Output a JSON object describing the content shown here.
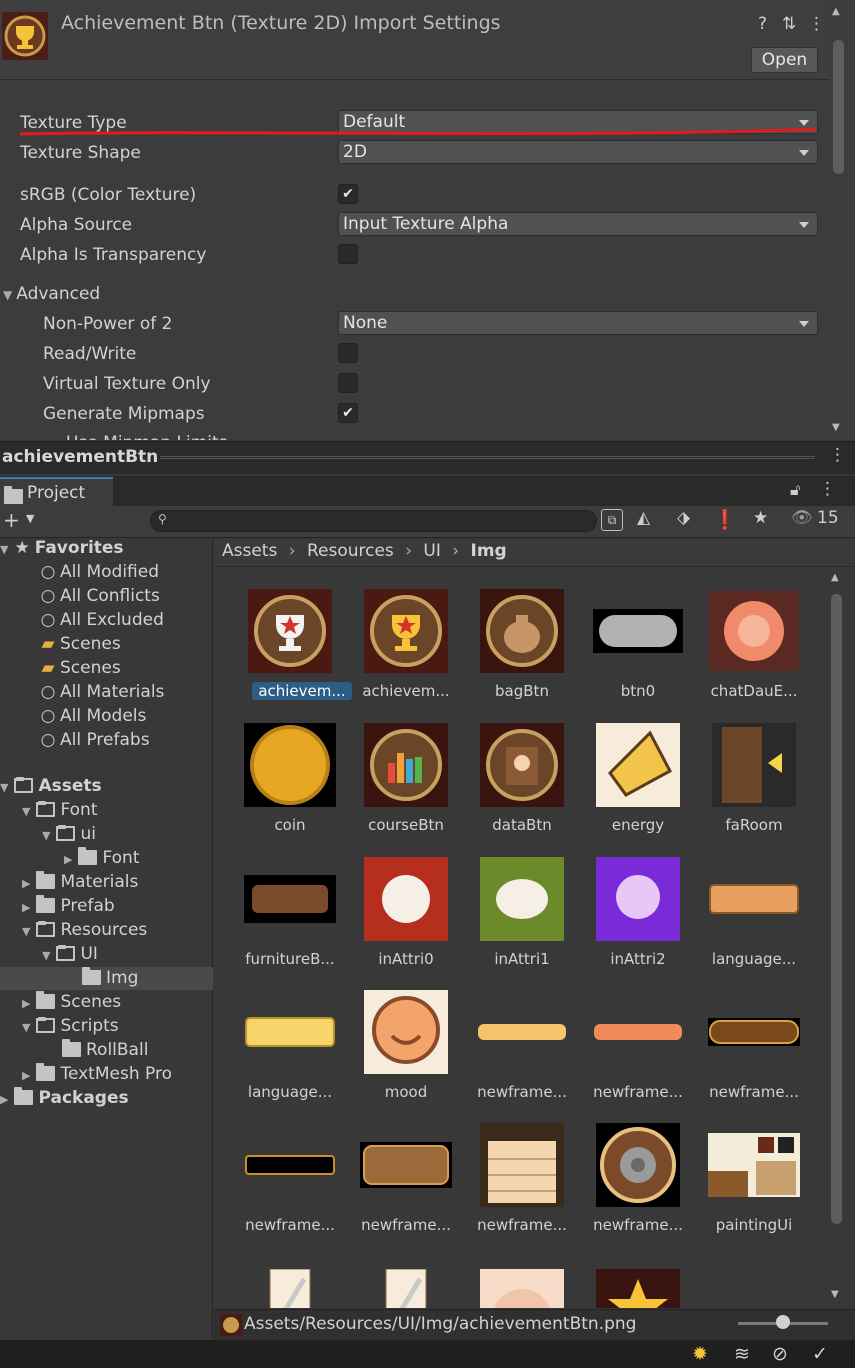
{
  "inspector": {
    "title": "Achievement Btn (Texture 2D) Import Settings",
    "open_label": "Open",
    "help_icon": "?",
    "settings_icon": "⇅",
    "menu_icon": "⋮",
    "rows": {
      "texture_type": {
        "label": "Texture Type",
        "value": "Default"
      },
      "texture_shape": {
        "label": "Texture Shape",
        "value": "2D"
      },
      "srgb": {
        "label": "sRGB (Color Texture)",
        "checked": true
      },
      "alpha_source": {
        "label": "Alpha Source",
        "value": "Input Texture Alpha"
      },
      "alpha_transparency": {
        "label": "Alpha Is Transparency",
        "checked": false
      },
      "advanced": {
        "label": "Advanced"
      },
      "npot": {
        "label": "Non-Power of 2",
        "value": "None"
      },
      "readwrite": {
        "label": "Read/Write",
        "checked": false
      },
      "virtual_texture": {
        "label": "Virtual Texture Only",
        "checked": false
      },
      "mipmaps": {
        "label": "Generate Mipmaps",
        "checked": true
      },
      "partial_next": {
        "label": "Use Mipmap Limits"
      }
    },
    "check_glyph": "✔",
    "annotation_color": "#e8191b"
  },
  "preview": {
    "title": "achievementBtn"
  },
  "project": {
    "tab_label": "Project",
    "visible_count": "15",
    "breadcrumb": [
      "Assets",
      "Resources",
      "UI",
      "Img"
    ],
    "favorites": {
      "label": "Favorites",
      "items": [
        "All Modified",
        "All Conflicts",
        "All Excluded",
        "Scenes",
        "Scenes",
        "All Materials",
        "All Models",
        "All Prefabs"
      ]
    },
    "tree": [
      {
        "label": "Assets",
        "bold": true
      },
      {
        "label": "Font"
      },
      {
        "label": "ui"
      },
      {
        "label": "Font"
      },
      {
        "label": "Materials"
      },
      {
        "label": "Prefab"
      },
      {
        "label": "Resources"
      },
      {
        "label": "UI"
      },
      {
        "label": "Img"
      },
      {
        "label": "Scenes"
      },
      {
        "label": "Scripts"
      },
      {
        "label": "RollBall"
      },
      {
        "label": "TextMesh Pro"
      },
      {
        "label": "Packages",
        "bold": true
      }
    ],
    "assets": [
      "achievem...",
      "achievem...",
      "bagBtn",
      "btn0",
      "chatDauE...",
      "coin",
      "courseBtn",
      "dataBtn",
      "energy",
      "faRoom",
      "furnitureB...",
      "inAttri0",
      "inAttri1",
      "inAttri2",
      "language...",
      "language...",
      "mood",
      "newframe...",
      "newframe...",
      "newframe...",
      "newframe...",
      "newframe...",
      "newframe...",
      "newframe...",
      "paintingUi"
    ],
    "status_path": "Assets/Resources/UI/Img/achievementBtn.png"
  }
}
